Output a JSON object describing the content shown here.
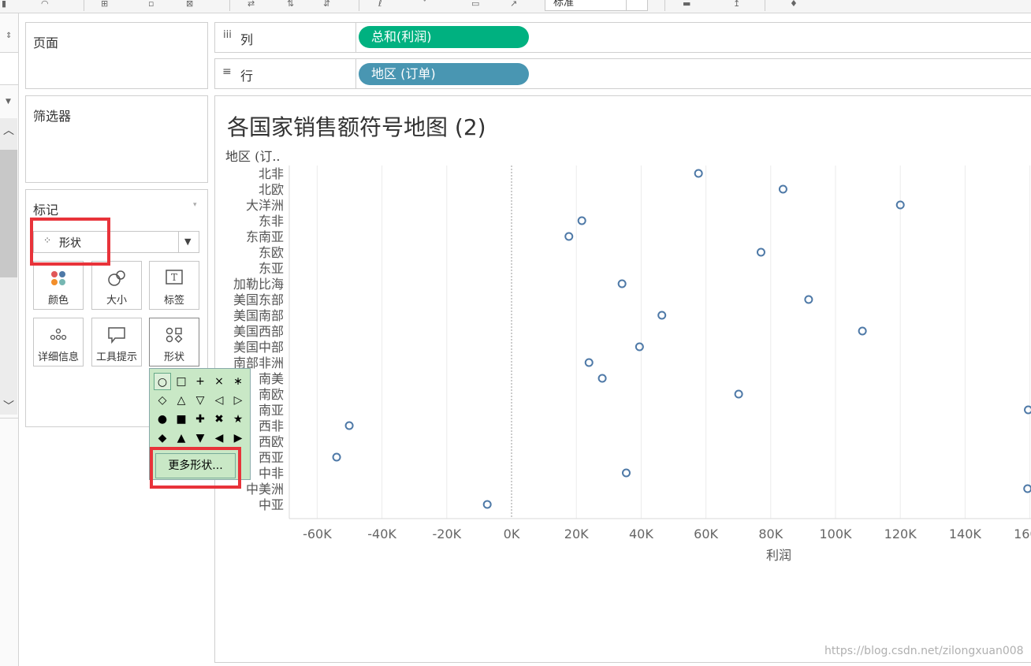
{
  "toolbar": {
    "combo_value": "标准"
  },
  "panes": {
    "pages": "页面",
    "filters": "筛选器",
    "marks": {
      "title": "标记",
      "mark_type": "形状",
      "cards": [
        "颜色",
        "大小",
        "标签",
        "详细信息",
        "工具提示",
        "形状"
      ]
    }
  },
  "shelves": {
    "columns": {
      "name": "列",
      "pill": "总和(利润)"
    },
    "rows": {
      "name": "行",
      "pill": "地区 (订单)"
    }
  },
  "shape_palette": {
    "rows": [
      [
        "○",
        "□",
        "+",
        "×",
        "∗"
      ],
      [
        "◇",
        "△",
        "▽",
        "◁",
        "▷"
      ],
      [
        "●",
        "■",
        "✚",
        "✖",
        "★"
      ],
      [
        "◆",
        "▲",
        "▼",
        "◀",
        "▶"
      ]
    ],
    "more_button": "更多形状..."
  },
  "view": {
    "title": "各国家销售额符号地图 (2)"
  },
  "chart_data": {
    "type": "scatter",
    "title": "各国家销售额符号地图 (2)",
    "row_header": "地区 (订..",
    "xlabel": "利润",
    "xlim": [
      -70000,
      160000
    ],
    "x_ticks": [
      "-60K",
      "-40K",
      "-20K",
      "0K",
      "20K",
      "40K",
      "60K",
      "80K",
      "100K",
      "120K",
      "140K",
      "160K"
    ],
    "x_tick_values": [
      -60000,
      -40000,
      -20000,
      0,
      20000,
      40000,
      60000,
      80000,
      100000,
      120000,
      140000,
      160000
    ],
    "categories": [
      "北非",
      "北欧",
      "大洋洲",
      "东非",
      "东南亚",
      "东欧",
      "东亚",
      "加勒比海",
      "美国东部",
      "美国南部",
      "美国西部",
      "美国中部",
      "南部非洲",
      "南美",
      "南欧",
      "南亚",
      "西非",
      "西欧",
      "西亚",
      "中非",
      "中美洲",
      "中亚"
    ],
    "values": [
      57700,
      83800,
      120000,
      21700,
      17700,
      77000,
      null,
      34100,
      91700,
      46400,
      108300,
      39500,
      23900,
      28000,
      70100,
      159500,
      -50100,
      null,
      -54000,
      35400,
      159300,
      -7500
    ],
    "marker": "open-circle",
    "color": "#4e79a7",
    "grid": true
  },
  "watermark": "https://blog.csdn.net/zilongxuan008"
}
